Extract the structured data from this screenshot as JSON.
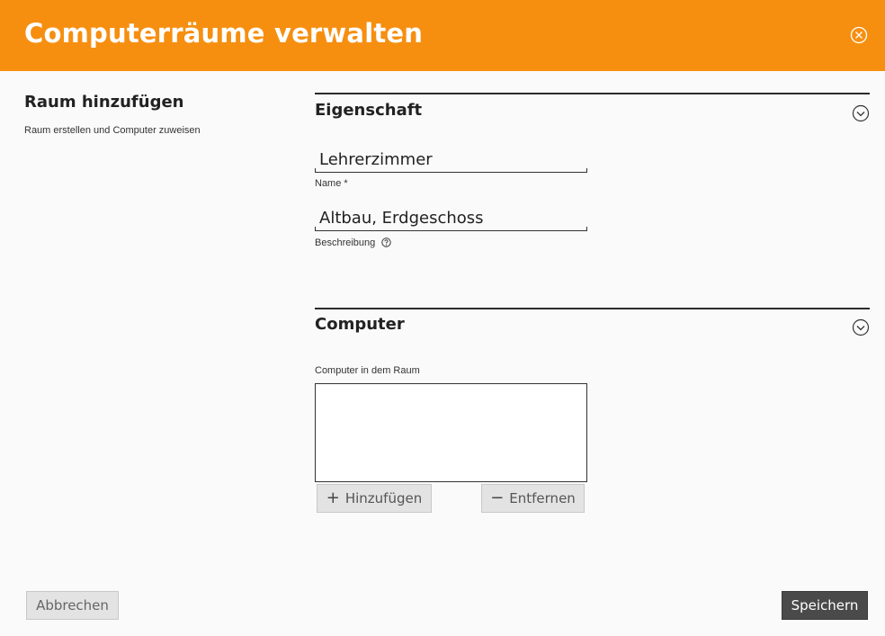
{
  "header": {
    "title": "Computerräume verwalten",
    "close_icon": "close-circle-icon",
    "accent_color": "#f68f10"
  },
  "sidebar": {
    "title": "Raum hinzufügen",
    "subtitle": "Raum erstellen und Computer zuweisen"
  },
  "properties": {
    "title": "Eigenschaft",
    "toggle_icon": "chevron-down-circle-icon",
    "name": {
      "value": "Lehrerzimmer",
      "label": "Name *"
    },
    "description": {
      "value": "Altbau, Erdgeschoss",
      "label": "Beschreibung",
      "help_icon": "help-circle-icon"
    }
  },
  "computers": {
    "title": "Computer",
    "toggle_icon": "chevron-down-circle-icon",
    "list_label": "Computer in dem Raum",
    "items": [],
    "add_label": "Hinzufügen",
    "add_icon": "plus-icon",
    "remove_label": "Entfernen",
    "remove_icon": "minus-icon"
  },
  "footer": {
    "cancel_label": "Abbrechen",
    "save_label": "Speichern"
  }
}
